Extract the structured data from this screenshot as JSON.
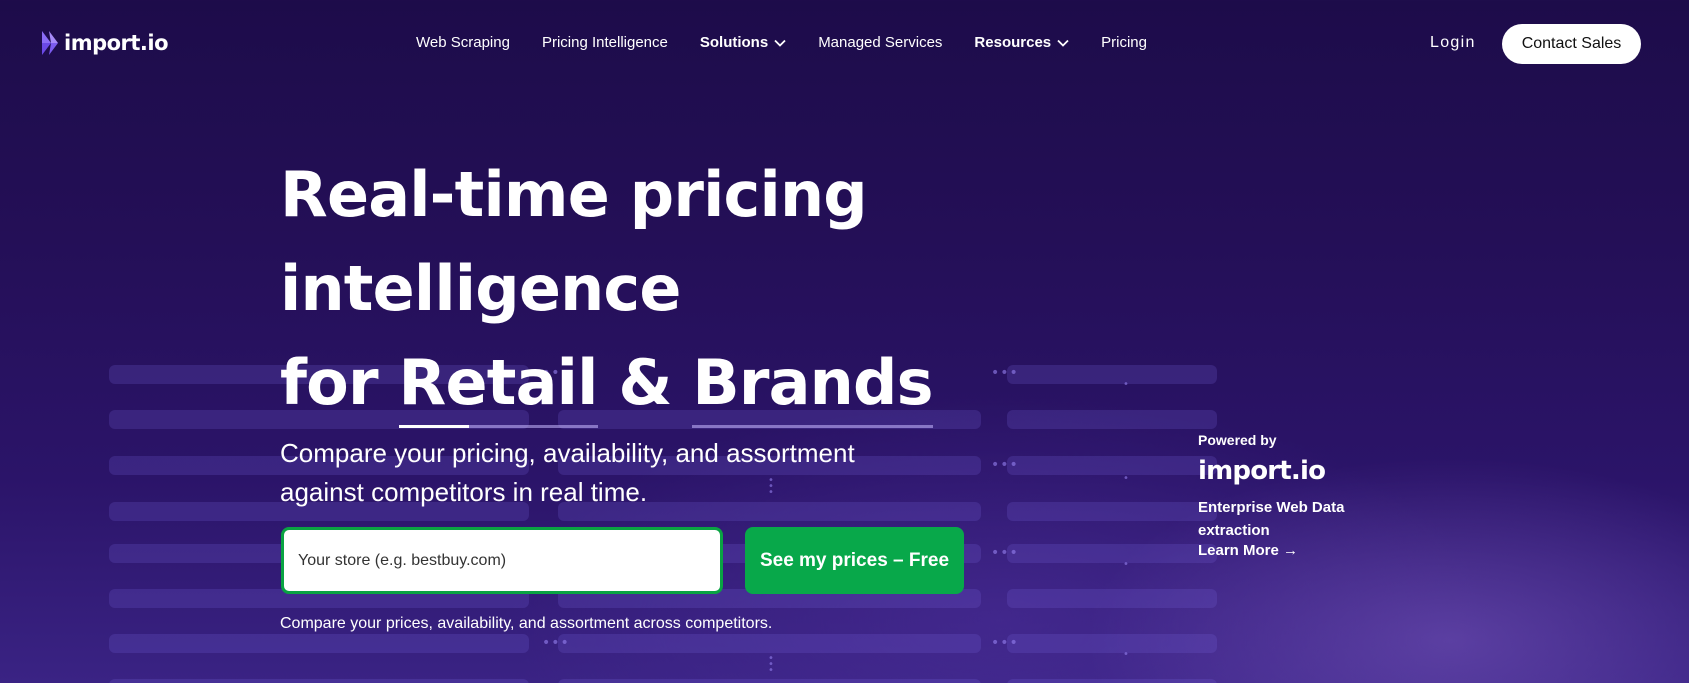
{
  "header": {
    "logo_text": "import.io",
    "nav": [
      {
        "label": "Web Scraping",
        "dropdown": false
      },
      {
        "label": "Pricing Intelligence",
        "dropdown": false
      },
      {
        "label": "Solutions",
        "dropdown": true
      },
      {
        "label": "Managed Services",
        "dropdown": false
      },
      {
        "label": "Resources",
        "dropdown": true
      },
      {
        "label": "Pricing",
        "dropdown": false
      }
    ],
    "login_label": "Login",
    "contact_label": "Contact Sales"
  },
  "hero": {
    "title_line1": "Real-time pricing",
    "title_line2": "intelligence",
    "title_for": "for",
    "title_word_retail": "Retail",
    "title_amp": "&",
    "title_word_brands": "Brands",
    "subtitle": "Compare your pricing, availability, and assortment against competitors in real time.",
    "store_placeholder": "Your store (e.g. bestbuy.com)",
    "cta_label": "See my prices – Free",
    "note": "Compare your prices, availability, and assortment across competitors."
  },
  "powered": {
    "label": "Powered by",
    "logo_text": "import.io",
    "description": "Enterprise Web Data extraction",
    "learn_more": "Learn More →"
  },
  "colors": {
    "background_top": "#1d0c4a",
    "background_bottom": "#3a2384",
    "cta_green": "#08a84a",
    "logo_purple": "#7b5cf0"
  }
}
